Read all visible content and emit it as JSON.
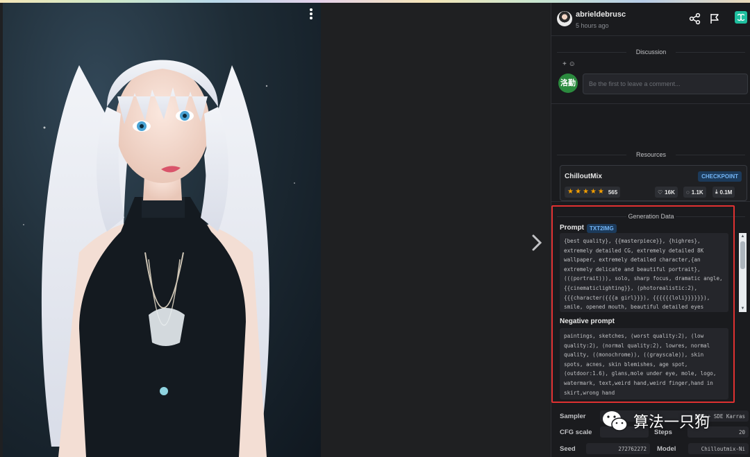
{
  "post": {
    "username": "abrieldebrusc",
    "time_ago": "5 hours ago"
  },
  "discussion": {
    "title": "Discussion",
    "react_label": "+ ☺",
    "my_avatar_text": "洛勤",
    "comment_placeholder": "Be the first to leave a comment..."
  },
  "resources": {
    "title": "Resources",
    "items": [
      {
        "name": "ChilloutMix",
        "type": "CHECKPOINT",
        "stars": 5,
        "rating_count": "565",
        "likes": "16K",
        "comments": "1.1K",
        "downloads": "0.1M"
      }
    ]
  },
  "generation_data": {
    "title": "Generation Data",
    "prompt_label": "Prompt",
    "prompt_badge": "TXT2IMG",
    "prompt": "{best quality}, {{masterpiece}}, {highres}, extremely detailed CG, extremely detailed 8K wallpaper, extremely detailed character,{an extremely delicate and beautiful portrait}, (((portrait))), solo, sharp focus, dramatic angle, {{cinematiclighting}}, (photorealistic:2), {{{character({{{a girl}}}), {{{{{{loli}}}}}}), smile, opened mouth, beautiful detailed eyes",
    "negative_label": "Negative prompt",
    "negative_prompt": "paintings, sketches, (worst quality:2), (low quality:2), (normal quality:2), lowres, normal quality, ((monochrome)), ((grayscale)), skin spots, acnes, skin blemishes, age spot, (outdoor:1.6), glans,mole under eye, mole, logo, watermark, text,weird hand,weird finger,hand in skirt,wrong hand",
    "sampler_label": "Sampler",
    "sampler": "DPM++ SDE Karras",
    "cfg_label": "CFG scale",
    "cfg": "",
    "steps_label": "Steps",
    "steps": "20",
    "seed_label": "Seed",
    "seed": "272762272",
    "model_label": "Model",
    "model": "Chilloutmix-Ni"
  },
  "watermark": {
    "text": "算法一只狗"
  },
  "colors": {
    "accent_badge": "#74b5f5",
    "highlight": "#e03131",
    "star": "#f59f00",
    "avatar_green": "#2b8a3e"
  }
}
